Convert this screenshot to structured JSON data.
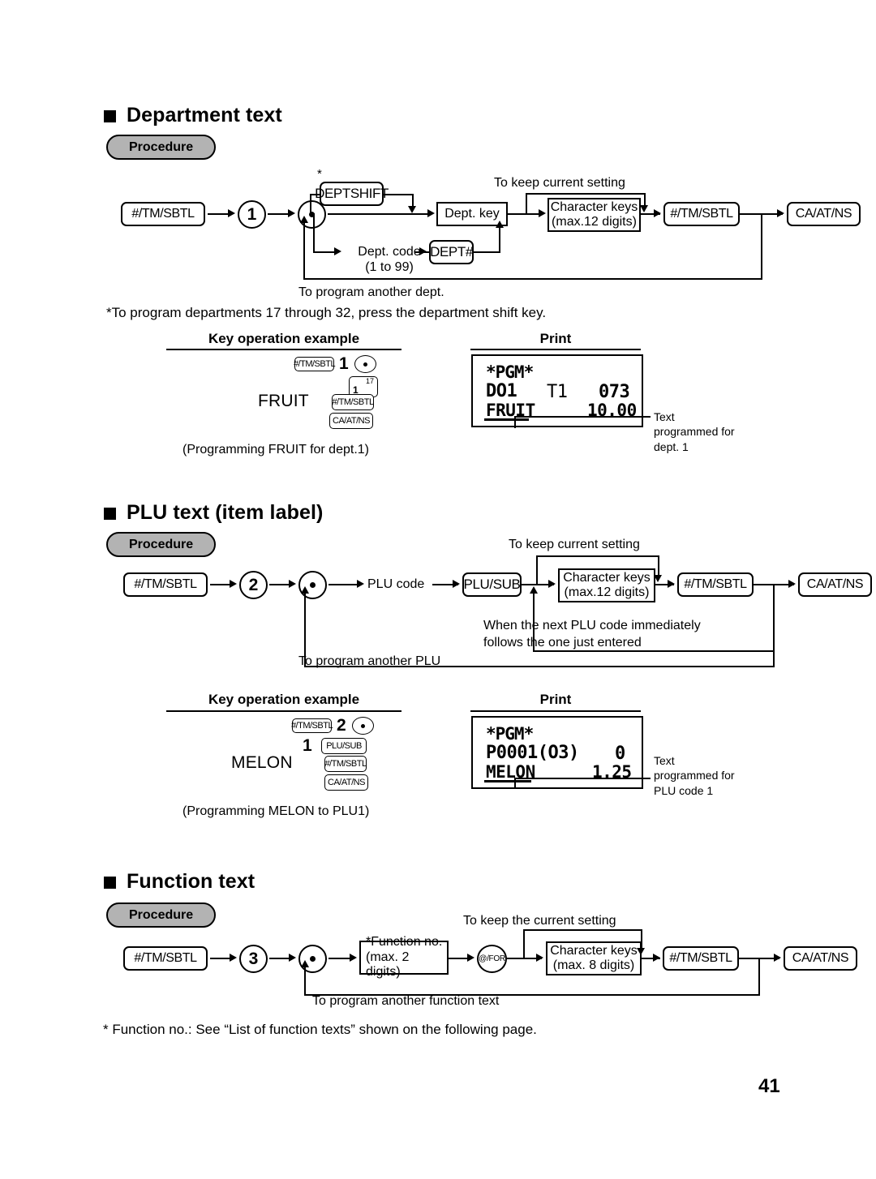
{
  "page": {
    "number": "41"
  },
  "sections": [
    {
      "id": "department-text",
      "heading": "Department text",
      "procedure_label": "Procedure",
      "flow": {
        "start_key": "#/TM/SBTL",
        "mode_number": "1",
        "dot_key": "•",
        "shift_key": "DEPTSHIFT",
        "shift_asterisk": "*",
        "dept_key": "Dept. key",
        "dept_code_line1": "Dept. code",
        "dept_code_line2": "(1 to 99)",
        "dept_hash_key": "DEPT#",
        "keep_setting": "To keep current setting",
        "char_keys_line1": "Character keys",
        "char_keys_line2": "(max.12 digits)",
        "subtotal_key": "#/TM/SBTL",
        "finalize_key": "CA/AT/NS",
        "loop_label": "To program another dept."
      },
      "footnote": "*To program departments 17 through 32, press the department shift key.",
      "example": {
        "title": "Key operation example",
        "row1_key": "#/TM/SBTL",
        "row1_num": "1",
        "row1_dot": "•",
        "dept_key_low": "1",
        "dept_key_high": "17",
        "word": "FRUIT",
        "row3_key": "#/TM/SBTL",
        "row4_key": "CA/AT/NS",
        "caption": "(Programming FRUIT for dept.1)"
      },
      "print": {
        "title": "Print",
        "line1": "*PGM*",
        "line2_left": "DO1",
        "line2_mid": "T1",
        "line2_right": "073",
        "line3_left": "FRUIT",
        "line3_right": "10.00",
        "callout": "Text\nprogrammed for\ndept. 1"
      }
    },
    {
      "id": "plu-text",
      "heading": "PLU text (item label)",
      "procedure_label": "Procedure",
      "flow": {
        "start_key": "#/TM/SBTL",
        "mode_number": "2",
        "dot_key": "•",
        "plu_code": "PLU code",
        "plu_sub_key": "PLU/SUB",
        "keep_setting": "To keep current setting",
        "char_keys_line1": "Character keys",
        "char_keys_line2": "(max.12 digits)",
        "subtotal_key": "#/TM/SBTL",
        "finalize_key": "CA/AT/NS",
        "inner_loop_line1": "When the next PLU code immediately",
        "inner_loop_line2": "follows the one just entered",
        "loop_label": "To program another PLU"
      },
      "example": {
        "title": "Key operation example",
        "row1_key": "#/TM/SBTL",
        "row1_num": "2",
        "row1_dot": "•",
        "row2_num": "1",
        "row2_key": "PLU/SUB",
        "word": "MELON",
        "row3_key": "#/TM/SBTL",
        "row4_key": "CA/AT/NS",
        "caption": "(Programming MELON to PLU1)"
      },
      "print": {
        "title": "Print",
        "line1": "*PGM*",
        "line2_left": "P0001(O3)",
        "line2_right": "0",
        "line3_left": "MELON",
        "line3_right": "1.25",
        "callout": "Text\nprogrammed for\nPLU code 1"
      }
    },
    {
      "id": "function-text",
      "heading": "Function text",
      "procedure_label": "Procedure",
      "flow": {
        "start_key": "#/TM/SBTL",
        "mode_number": "3",
        "dot_key": "•",
        "func_no_line1": "*Function no.",
        "func_no_line2": "(max. 2 digits)",
        "for_key": "@/FOR",
        "keep_setting": "To keep the current setting",
        "char_keys_line1": "Character keys",
        "char_keys_line2": "(max. 8 digits)",
        "subtotal_key": "#/TM/SBTL",
        "finalize_key": "CA/AT/NS",
        "loop_label": "To program another function text"
      },
      "footnote": "* Function no.: See “List of function texts” shown on the following page."
    }
  ]
}
